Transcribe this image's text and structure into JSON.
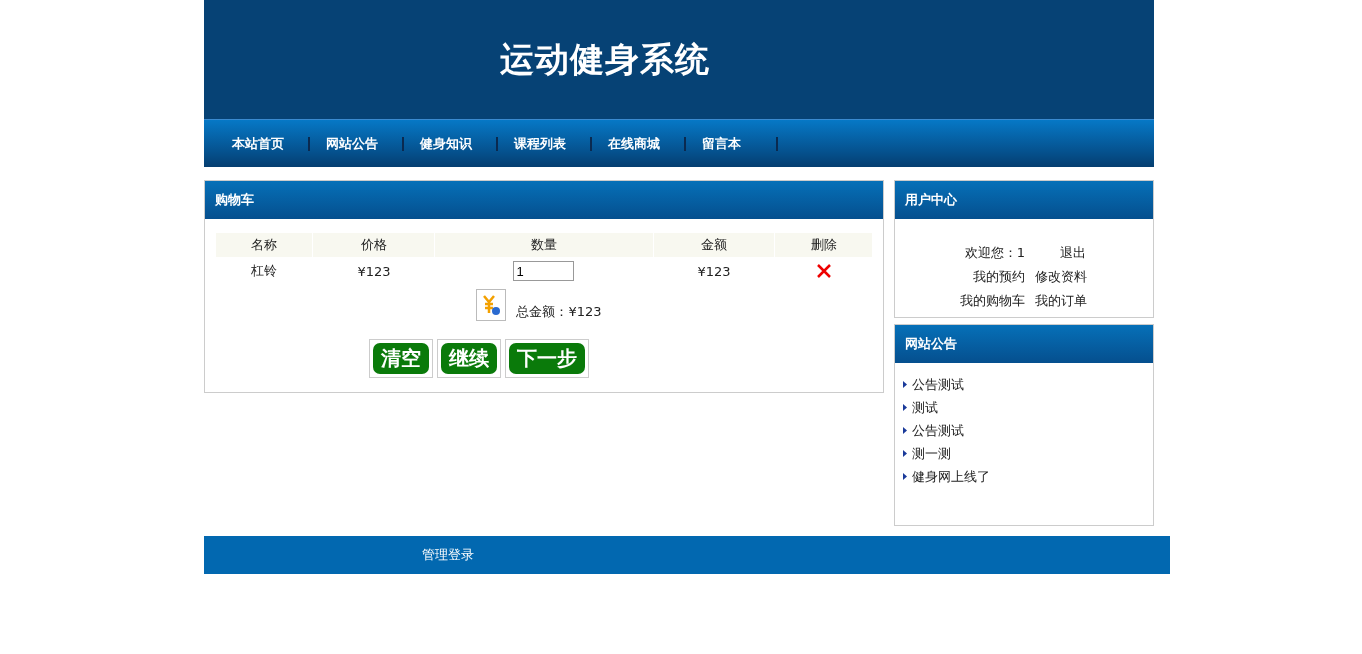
{
  "header": {
    "title": "运动健身系统"
  },
  "nav": [
    {
      "label": "本站首页"
    },
    {
      "label": "网站公告"
    },
    {
      "label": "健身知识"
    },
    {
      "label": "课程列表"
    },
    {
      "label": "在线商城"
    },
    {
      "label": "留言本"
    }
  ],
  "cart": {
    "title": "购物车",
    "columns": [
      "名称",
      "价格",
      "数量",
      "金额",
      "删除"
    ],
    "rows": [
      {
        "name": "杠铃",
        "price": "¥123",
        "quantity": "1",
        "amount": "¥123"
      }
    ],
    "total": "总金额：¥123",
    "buttons": [
      "清空",
      "继续",
      "下一步"
    ]
  },
  "user_center": {
    "title": "用户中心",
    "welcome": "欢迎您：1",
    "links": [
      "退出",
      "我的预约",
      "修改资料",
      "我的购物车",
      "我的订单"
    ]
  },
  "notices": {
    "title": "网站公告",
    "items": [
      "公告测试",
      "测试",
      "公告测试",
      "测一测",
      "健身网上线了"
    ]
  },
  "footer": {
    "link": "管理登录"
  }
}
